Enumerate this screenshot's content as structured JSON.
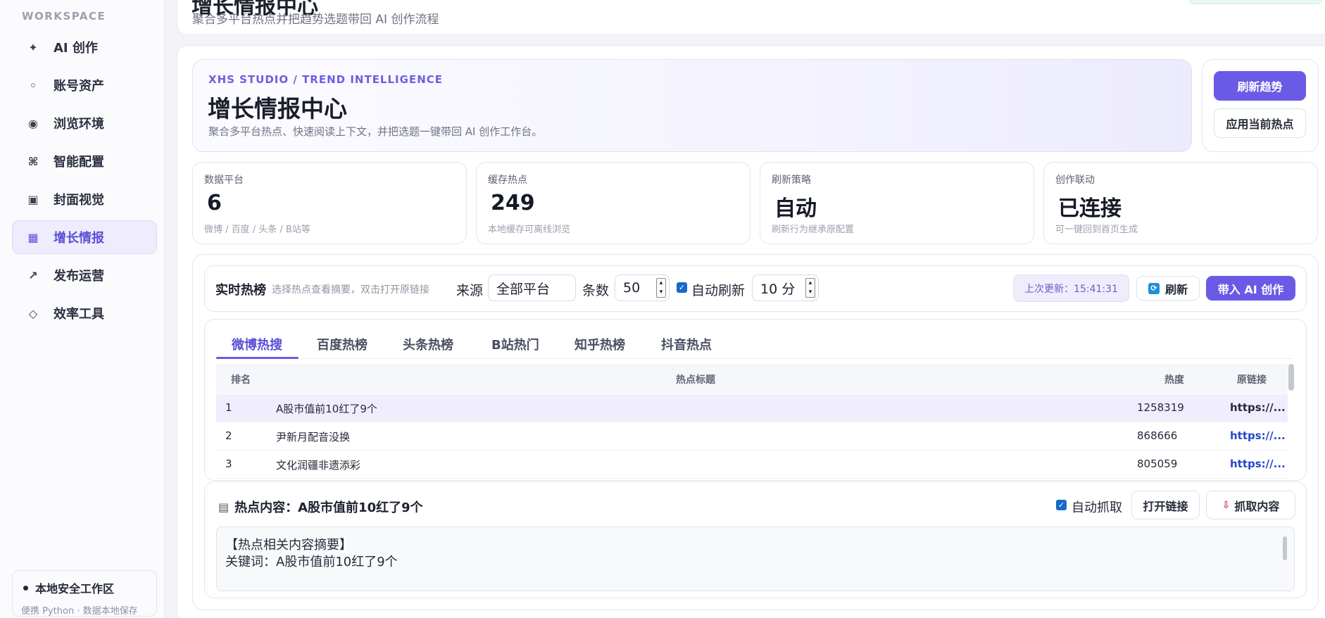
{
  "sidebar": {
    "section_label": "WORKSPACE",
    "items": [
      {
        "icon": "sparkle-icon",
        "glyph": "✦",
        "label": "AI 创作"
      },
      {
        "icon": "small-dot-icon",
        "glyph": "◦",
        "label": "账号资产"
      },
      {
        "icon": "globe-icon",
        "glyph": "◉",
        "label": "浏览环境"
      },
      {
        "icon": "command-icon",
        "glyph": "⌘",
        "label": "智能配置"
      },
      {
        "icon": "frame-icon",
        "glyph": "▣",
        "label": "封面视觉"
      },
      {
        "icon": "grid-icon",
        "glyph": "▦",
        "label": "增长情报"
      },
      {
        "icon": "arrow-up-right-icon",
        "glyph": "↗",
        "label": "发布运营"
      },
      {
        "icon": "diamond-icon",
        "glyph": "◇",
        "label": "效率工具"
      }
    ],
    "active_index": 5,
    "footer": {
      "title": "本地安全工作区",
      "subtitle": "便携 Python · 数据本地保存"
    }
  },
  "header": {
    "title": "增长情报中心",
    "subtitle": "聚合多平台热点并把趋势选题带回 AI 创作流程"
  },
  "hero": {
    "kicker": "XHS STUDIO / TREND INTELLIGENCE",
    "title": "增长情报中心",
    "subtitle": "聚合多平台热点、快速阅读上下文，并把选题一键带回 AI 创作工作台。",
    "refresh_button": "刷新趋势",
    "apply_button": "应用当前热点"
  },
  "stats": [
    {
      "label": "数据平台",
      "value": "6",
      "note": "微博 / 百度 / 头条 / B站等"
    },
    {
      "label": "缓存热点",
      "value": "249",
      "note": "本地缓存可离线浏览"
    },
    {
      "label": "刷新策略",
      "value": "自动",
      "note": "刷新行为继承原配置"
    },
    {
      "label": "创作联动",
      "value": "已连接",
      "note": "可一键回到首页生成"
    }
  ],
  "toolbar": {
    "title": "实时热榜",
    "hint": "选择热点查看摘要，双击打开原链接",
    "source_label": "来源",
    "source_value": "全部平台",
    "count_label": "条数",
    "count_value": "50",
    "auto_refresh_label": "自动刷新",
    "interval_value": "10 分",
    "last_update": "上次更新：15:41:31",
    "refresh_button": "刷新",
    "ai_button": "带入 AI 创作"
  },
  "tabs": [
    "微博热搜",
    "百度热榜",
    "头条热榜",
    "B站热门",
    "知乎热榜",
    "抖音热点"
  ],
  "table": {
    "columns": [
      "排名",
      "热点标题",
      "热度",
      "原链接"
    ],
    "rows": [
      {
        "rank": "1",
        "title": "A股市值前10红了9个",
        "heat": "1258319",
        "link": "https://..."
      },
      {
        "rank": "2",
        "title": "尹新月配音没换",
        "heat": "868666",
        "link": "https://..."
      },
      {
        "rank": "3",
        "title": "文化润疆非遗添彩",
        "heat": "805059",
        "link": "https://..."
      }
    ]
  },
  "content": {
    "title": "热点内容：A股市值前10红了9个",
    "auto_fetch_label": "自动抓取",
    "open_link_button": "打开链接",
    "fetch_button": "抓取内容",
    "summary_line1": "【热点相关内容摘要】",
    "summary_line2": "关键词：A股市值前10红了9个"
  },
  "colors": {
    "accent": "#6a5ae6",
    "active_nav_bg": "#eeecfd",
    "link": "#2448c8",
    "checkbox": "#1769c9"
  }
}
